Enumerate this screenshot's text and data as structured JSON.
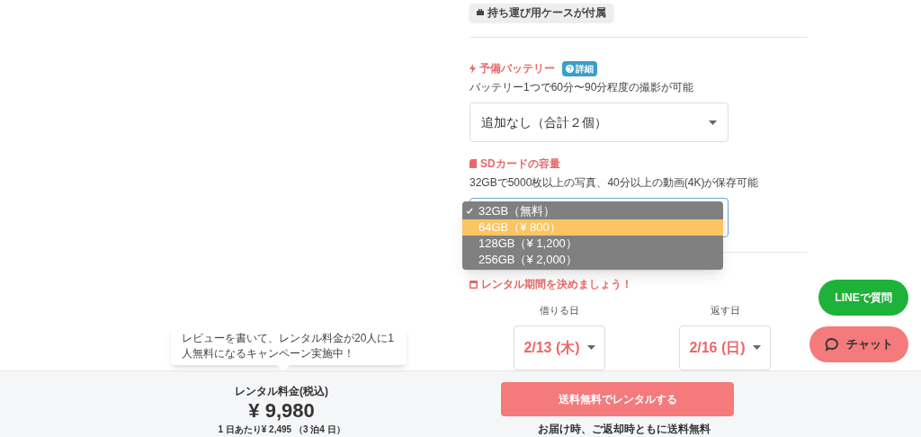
{
  "case_tag": "持ち運び用ケースが付属",
  "battery": {
    "title": "予備バッテリー",
    "detail_badge": "詳細",
    "description": "バッテリー1つで60分〜90分程度の撮影が可能",
    "select_value": "追加なし（合計２個）"
  },
  "sd_card": {
    "title": "SDカードの容量",
    "description": "32GBで5000枚以上の写真、40分以上の動画(4K)が保存可能",
    "options": [
      {
        "label": "32GB（無料）",
        "checked": true,
        "highlighted": false
      },
      {
        "label": "64GB（¥ 800）",
        "checked": false,
        "highlighted": true
      },
      {
        "label": "128GB（¥ 1,200）",
        "checked": false,
        "highlighted": false
      },
      {
        "label": "256GB（¥ 2,000）",
        "checked": false,
        "highlighted": false
      }
    ]
  },
  "rental_period": {
    "title": "レンタル期間を決めましょう！",
    "start": {
      "label": "借りる日",
      "value": "2/13 (木)"
    },
    "end": {
      "label": "返す日",
      "value": "2/16 (日)"
    }
  },
  "tooltip": "レビューを書いて、レンタル料金が20人に1人無料になるキャンペーン実施中！",
  "price": {
    "label": "レンタル料金(税込)",
    "amount": "¥ 9,980",
    "per_day": "1 日あたり¥ 2,495 （3 泊4 日）"
  },
  "rent_button": "送料無料でレンタルする",
  "shipping_note": "お届け時、ご返却時ともに送料無料",
  "line_button": "LINEで質問",
  "chat_button": "チャット"
}
